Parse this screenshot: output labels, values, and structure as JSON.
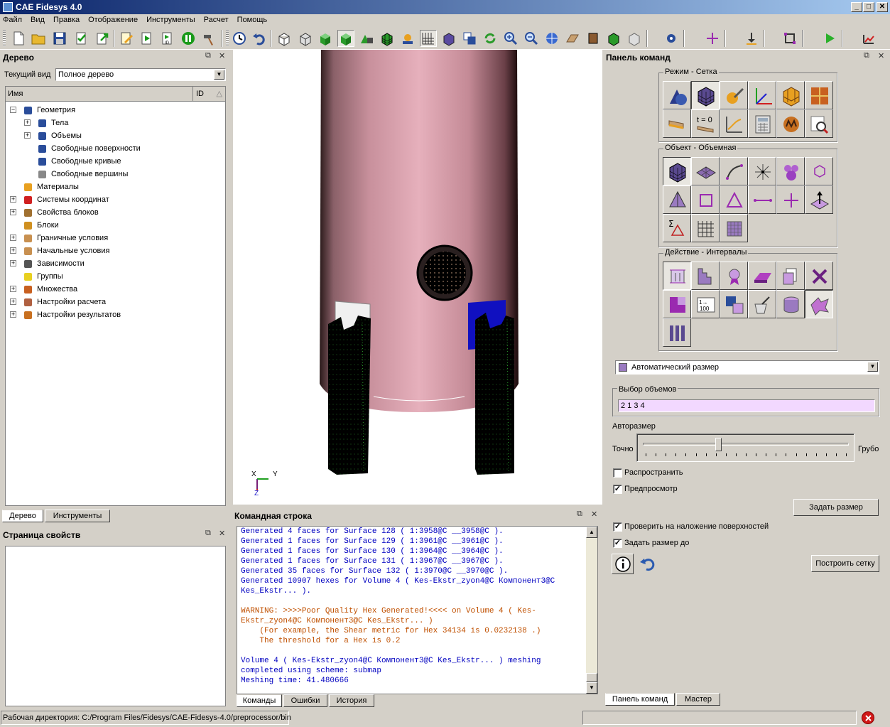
{
  "window": {
    "title": "CAE Fidesys 4.0",
    "minimize": "_",
    "maximize": "□",
    "close": "✕"
  },
  "menu": [
    "Файл",
    "Вид",
    "Правка",
    "Отображение",
    "Инструменты",
    "Расчет",
    "Помощь"
  ],
  "tree_panel": {
    "title": "Дерево",
    "float_btn": "⧉",
    "close_btn": "✕",
    "current_view_label": "Текущий вид",
    "current_view_value": "Полное дерево",
    "col_name": "Имя",
    "col_id": "ID",
    "items": [
      {
        "label": "Геометрия",
        "level": 0,
        "exp": "−",
        "icon": "geometry-icon"
      },
      {
        "label": "Тела",
        "level": 1,
        "exp": "+",
        "icon": "body-icon"
      },
      {
        "label": "Объемы",
        "level": 1,
        "exp": "+",
        "icon": "volume-icon"
      },
      {
        "label": "Свободные поверхности",
        "level": 1,
        "exp": "",
        "icon": "surface-icon"
      },
      {
        "label": "Свободные кривые",
        "level": 1,
        "exp": "",
        "icon": "curve-icon"
      },
      {
        "label": "Свободные вершины",
        "level": 1,
        "exp": "",
        "icon": "vertex-icon"
      },
      {
        "label": "Материалы",
        "level": 0,
        "exp": "",
        "icon": "materials-icon"
      },
      {
        "label": "Системы координат",
        "level": 0,
        "exp": "+",
        "icon": "coordinate-system-icon"
      },
      {
        "label": "Свойства блоков",
        "level": 0,
        "exp": "+",
        "icon": "block-properties-icon"
      },
      {
        "label": "Блоки",
        "level": 0,
        "exp": "",
        "icon": "blocks-icon"
      },
      {
        "label": "Граничные условия",
        "level": 0,
        "exp": "+",
        "icon": "boundary-conditions-icon"
      },
      {
        "label": "Начальные условия",
        "level": 0,
        "exp": "+",
        "icon": "initial-conditions-icon"
      },
      {
        "label": "Зависимости",
        "level": 0,
        "exp": "+",
        "icon": "dependencies-icon"
      },
      {
        "label": "Группы",
        "level": 0,
        "exp": "",
        "icon": "groups-icon"
      },
      {
        "label": "Множества",
        "level": 0,
        "exp": "+",
        "icon": "sets-icon"
      },
      {
        "label": "Настройки расчета",
        "level": 0,
        "exp": "+",
        "icon": "analysis-settings-icon"
      },
      {
        "label": "Настройки результатов",
        "level": 0,
        "exp": "+",
        "icon": "results-settings-icon"
      }
    ],
    "tabs": [
      "Дерево",
      "Инструменты"
    ]
  },
  "properties_panel": {
    "title": "Страница свойств"
  },
  "viewport": {
    "axis_x": "X",
    "axis_y": "Y",
    "axis_z": "Z"
  },
  "console": {
    "title": "Командная строка",
    "lines": [
      {
        "t": "Generated 4 faces for Surface 128 ( 1:3958@C __3958@C ).",
        "w": false
      },
      {
        "t": "Generated 1 faces for Surface 129 ( 1:3961@C __3961@C ).",
        "w": false
      },
      {
        "t": "Generated 1 faces for Surface 130 ( 1:3964@C __3964@C ).",
        "w": false
      },
      {
        "t": "Generated 1 faces for Surface 131 ( 1:3967@C __3967@C ).",
        "w": false
      },
      {
        "t": "Generated 35 faces for Surface 132 ( 1:3970@C __3970@C ).",
        "w": false
      },
      {
        "t": "Generated 10907 hexes for Volume 4 ( Kes-Ekstr_zyon4@C Компонент3@C",
        "w": false
      },
      {
        "t": "Kes_Ekstr... ).",
        "w": false
      },
      {
        "t": "",
        "w": false
      },
      {
        "t": "WARNING: >>>>Poor Quality Hex Generated!<<<< on Volume 4 ( Kes-",
        "w": true
      },
      {
        "t": "Ekstr_zyon4@C Компонент3@C Kes_Ekstr... )",
        "w": true
      },
      {
        "t": "    (For example, the Shear metric for Hex 34134 is 0.0232138 .)",
        "w": true
      },
      {
        "t": "    The threshold for a Hex is 0.2",
        "w": true
      },
      {
        "t": "",
        "w": false
      },
      {
        "t": "Volume 4 ( Kes-Ekstr_zyon4@C Компонент3@C Kes_Ekstr... ) meshing",
        "w": false
      },
      {
        "t": "completed using scheme: submap",
        "w": false
      },
      {
        "t": "Meshing time: 41.480666",
        "w": false
      }
    ],
    "tabs": [
      "Команды",
      "Ошибки",
      "История"
    ]
  },
  "command_panel": {
    "title": "Панель команд",
    "group_mode": "Режим - Сетка",
    "group_object": "Объект - Объемная",
    "group_action": "Действие - Интервалы",
    "t0_label": "t = 0",
    "interval_method": "Автоматический размер",
    "volume_select_label": "Выбор объемов",
    "volume_select_value": "2 1 3 4",
    "autosize_label": "Авторазмер",
    "fine_label": "Точно",
    "coarse_label": "Грубо",
    "slider_level": 0.35,
    "propagate_label": "Распространить",
    "propagate_checked": false,
    "preview_label": "Предпросмотр",
    "preview_checked": true,
    "set_size_btn": "Задать размер",
    "check_overlap_label": "Проверить на наложение поверхностей",
    "check_overlap_checked": true,
    "set_size_to_label": "Задать размер до",
    "set_size_to_checked": true,
    "build_mesh_btn": "Построить сетку",
    "tabs": [
      "Панель команд",
      "Мастер"
    ]
  },
  "status": {
    "workdir": "Рабочая директория: C:/Program Files/Fidesys/CAE-Fidesys-4.0/preprocessor/bin"
  }
}
